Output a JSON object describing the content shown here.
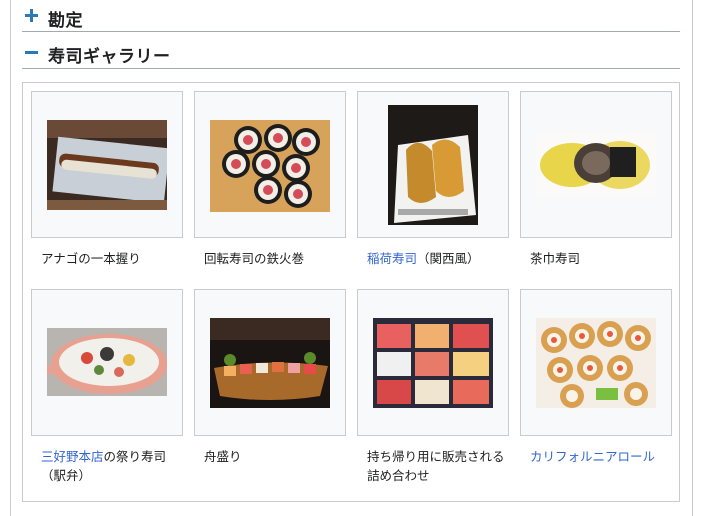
{
  "sections": [
    {
      "title": "勘定",
      "state": "collapsed",
      "icon": "plus-icon"
    },
    {
      "title": "寿司ギャラリー",
      "state": "expanded",
      "icon": "minus-icon"
    }
  ],
  "gallery": {
    "items": [
      {
        "caption": "アナゴの一本握り",
        "image": "anago-sushi-image"
      },
      {
        "caption": "回転寿司の鉄火巻",
        "image": "tekka-maki-image"
      },
      {
        "caption_link": "稲荷寿司",
        "caption_rest": "（関西風）",
        "image": "inari-sushi-image"
      },
      {
        "caption": "茶巾寿司",
        "image": "chakin-sushi-image"
      },
      {
        "caption_link": "三好野本店",
        "caption_rest": "の祭り寿司（駅弁）",
        "image": "matsuri-sushi-image"
      },
      {
        "caption": "舟盛り",
        "image": "funamori-image"
      },
      {
        "caption": "持ち帰り用に販売される詰め合わせ",
        "image": "takeout-sushi-image"
      },
      {
        "caption_link": "カリフォルニアロール",
        "caption_rest": "",
        "image": "california-roll-image"
      }
    ]
  },
  "colors": {
    "link": "#3366cc",
    "toggle": "#2a7ab8",
    "border": "#c8ccd1"
  }
}
